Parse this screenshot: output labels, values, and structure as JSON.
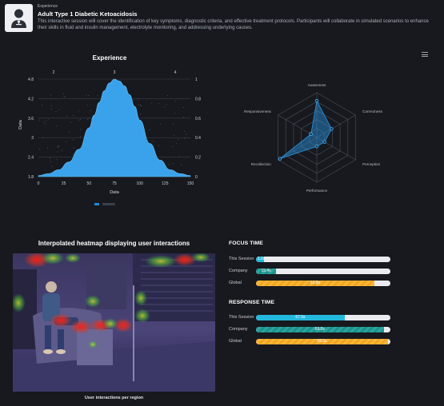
{
  "header": {
    "eyebrow": "Experience",
    "title": "Adult Type 1 Diabetic Ketoacidosis",
    "description": "This interactive session will cover the identification of key symptoms, diagnostic criteria, and effective treatment protocols. Participants will collaborate in simulated scenarios to enhance their skills in fluid and insulin management, electrolyte monitoring, and addressing underlying causes."
  },
  "icons": {
    "avatar": "user-avatar-icon",
    "menu": "hamburger-menu-icon"
  },
  "chart_data": [
    {
      "type": "area",
      "title": "Experience",
      "xlabel": "Data",
      "ylabel": "Data",
      "xlim": [
        0,
        150
      ],
      "ylim_left": [
        1.8,
        4.8
      ],
      "ylim_right": [
        0,
        1
      ],
      "x_ticks": [
        "0",
        "25",
        "50",
        "75",
        "100",
        "125",
        "150"
      ],
      "y_left_ticks": [
        "1.8",
        "2.4",
        "3",
        "3.6",
        "4.2",
        "4.8"
      ],
      "y_right_ticks": [
        "0",
        "0.2",
        "0.4",
        "0.6",
        "0.8",
        "1"
      ],
      "top_ticks": [
        "2",
        "3",
        "4"
      ],
      "density": {
        "x": [
          0,
          10,
          20,
          30,
          40,
          50,
          55,
          60,
          65,
          70,
          75,
          80,
          85,
          90,
          95,
          100,
          110,
          120,
          130,
          140,
          150
        ],
        "y": [
          0.01,
          0.03,
          0.07,
          0.15,
          0.28,
          0.5,
          0.63,
          0.76,
          0.88,
          0.96,
          1.0,
          0.98,
          0.93,
          0.84,
          0.72,
          0.58,
          0.34,
          0.17,
          0.07,
          0.03,
          0.01
        ]
      },
      "legend": [
        {
          "name": "",
          "color": "#1f8ad6"
        }
      ],
      "grid": true,
      "color": "#3aa2ea"
    },
    {
      "type": "radar",
      "axes": [
        "Awareness",
        "Correctness",
        "Perception",
        "Performance",
        "Recollection",
        "Responsiveness"
      ],
      "values": [
        0.82,
        0.38,
        0.2,
        0.2,
        0.95,
        0.15
      ],
      "max": 1,
      "rings": 5,
      "color": "#2a96e6"
    }
  ],
  "heatmap": {
    "title": "Interpolated heatmap displaying user interactions",
    "caption": "User interactions per region"
  },
  "focus_time": {
    "title": "FOCUS TIME",
    "rows": [
      {
        "label": "This Session",
        "value": "1.0s",
        "fraction": 0.06,
        "style": "solid-cyan"
      },
      {
        "label": "Company",
        "value": "15.4s",
        "fraction": 0.15,
        "style": "stripe-teal"
      },
      {
        "label": "Global",
        "value": "51.8s",
        "fraction": 0.88,
        "style": "stripe-orange"
      }
    ]
  },
  "response_time": {
    "title": "RESPONSE TIME",
    "rows": [
      {
        "label": "This Session",
        "value": "67.5s",
        "fraction": 0.66,
        "style": "solid-cyan"
      },
      {
        "label": "Company",
        "value": "69.0s",
        "fraction": 0.95,
        "style": "stripe-teal"
      },
      {
        "label": "Global",
        "value": "69.3s",
        "fraction": 0.98,
        "style": "stripe-orange"
      }
    ]
  }
}
